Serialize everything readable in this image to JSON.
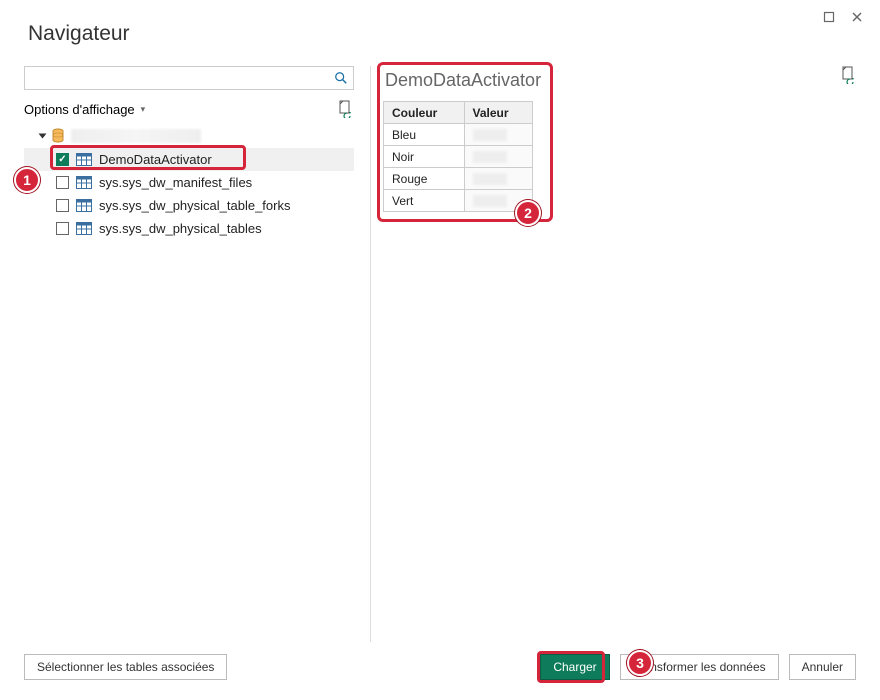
{
  "window": {
    "title": "Navigateur"
  },
  "search": {
    "placeholder": ""
  },
  "options": {
    "label": "Options d'affichage"
  },
  "tree": {
    "root_label": "",
    "items": [
      {
        "label": "DemoDataActivator",
        "checked": true,
        "selected": true
      },
      {
        "label": "sys.sys_dw_manifest_files",
        "checked": false,
        "selected": false
      },
      {
        "label": "sys.sys_dw_physical_table_forks",
        "checked": false,
        "selected": false
      },
      {
        "label": "sys.sys_dw_physical_tables",
        "checked": false,
        "selected": false
      }
    ]
  },
  "preview": {
    "title": "DemoDataActivator",
    "columns": [
      "Couleur",
      "Valeur"
    ],
    "rows": [
      {
        "c0": "Bleu",
        "c1": ""
      },
      {
        "c0": "Noir",
        "c1": ""
      },
      {
        "c0": "Rouge",
        "c1": ""
      },
      {
        "c0": "Vert",
        "c1": ""
      }
    ]
  },
  "footer": {
    "select_related": "Sélectionner les tables associées",
    "load": "Charger",
    "transform": "Transformer les données",
    "cancel": "Annuler"
  },
  "callouts": {
    "one": "1",
    "two": "2",
    "three": "3"
  }
}
